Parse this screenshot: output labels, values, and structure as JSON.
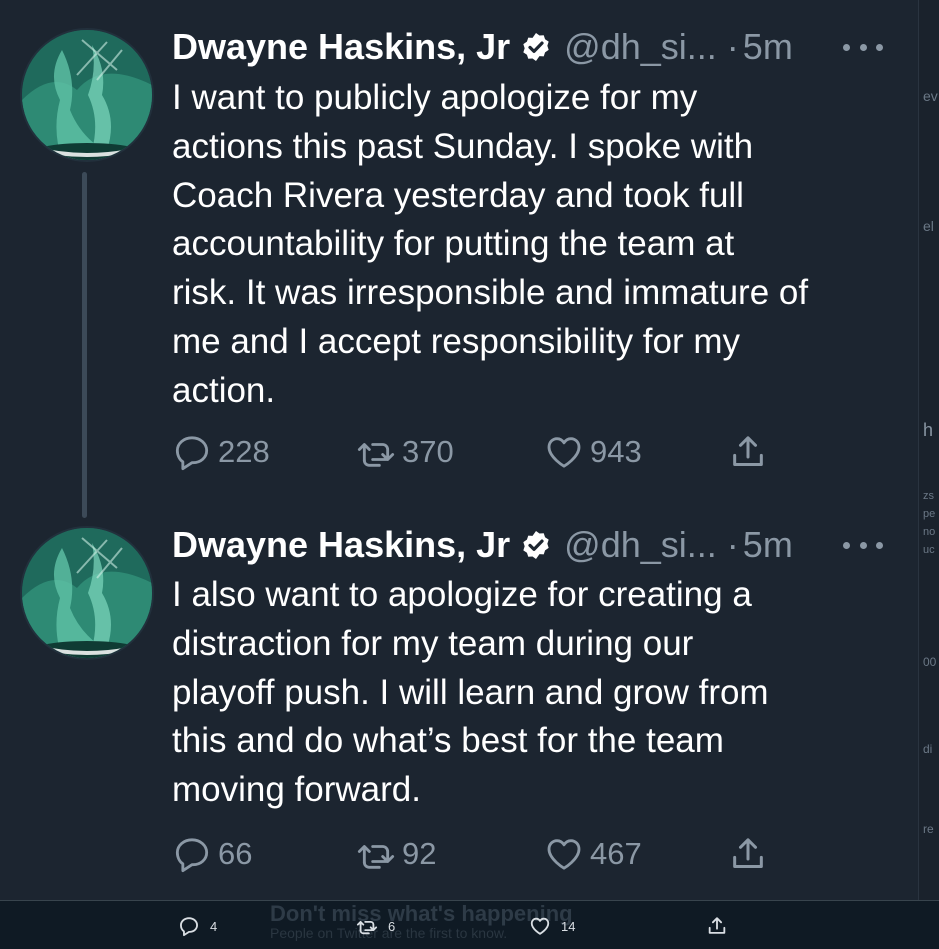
{
  "tweets": [
    {
      "name": "Dwayne Haskins, Jr",
      "handle": "@dh_si...",
      "separator": "·",
      "time": "5m",
      "text": "I want to publicly apologize for my actions this past Sunday. I spoke with Coach Rivera yesterday and took full accountability for putting the team at risk. It was irresponsible and immature of me and I accept responsibility for my action.",
      "lines": [
        "I want to publicly apologize for my",
        "actions this past Sunday. I spoke with",
        "Coach Rivera yesterday and took full",
        "accountability for putting the team at",
        "risk. It was irresponsible and immature of",
        "me and I accept responsibility for my",
        "action."
      ],
      "replies": "228",
      "retweets": "370",
      "likes": "943"
    },
    {
      "name": "Dwayne Haskins, Jr",
      "handle": "@dh_si...",
      "separator": "·",
      "time": "5m",
      "lines": [
        "I also want to apologize for creating a",
        "distraction for my team during our",
        "playoff push. I will learn and grow from",
        "this and do what’s best for the team",
        "moving forward."
      ],
      "replies": "66",
      "retweets": "92",
      "likes": "467"
    }
  ],
  "bottom_bar": {
    "banner_title": "Don't miss what's happening",
    "banner_sub": "People on Twitter are the first to know.",
    "replies": "4",
    "retweets": "6",
    "likes": "14"
  },
  "right_edge_fragments": [
    "ev",
    "el",
    "h",
    "zs",
    "pe",
    "no",
    "uc",
    "00",
    "di",
    "re"
  ],
  "colors": {
    "background": "#1c2530",
    "text": "#ffffff",
    "secondary": "#8b98a5",
    "thread_line": "#3c4a58"
  },
  "icons": [
    "verified-badge-icon",
    "more-icon",
    "reply-icon",
    "retweet-icon",
    "like-icon",
    "share-icon"
  ]
}
